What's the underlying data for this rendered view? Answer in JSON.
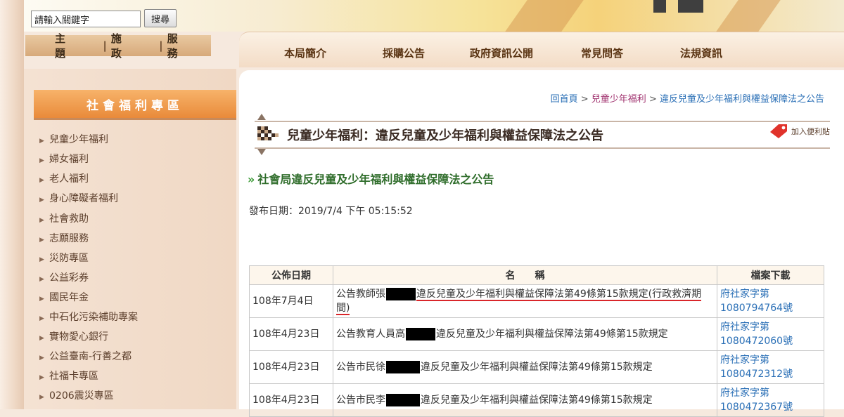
{
  "header": {
    "search": {
      "value": "請輸入關鍵字",
      "button_label": "搜尋"
    },
    "theme_tabs": [
      "主　題",
      "施　政",
      "服　務"
    ]
  },
  "top_nav": {
    "items": [
      "本局簡介",
      "採購公告",
      "政府資訊公開",
      "常見問答",
      "法規資訊"
    ]
  },
  "sidebar": {
    "title": "社會福利專區",
    "items": [
      "兒童少年福利",
      "婦女福利",
      "老人福利",
      "身心障礙者福利",
      "社會救助",
      "志願服務",
      "災防專區",
      "公益彩券",
      "國民年金",
      "中石化污染補助專案",
      "實物愛心銀行",
      "公益臺南-行善之都",
      "社福卡專區",
      "0206震災專區"
    ]
  },
  "breadcrumb": {
    "home": "回首頁",
    "sep": " > ",
    "category": "兒童少年福利",
    "current": "違反兒童及少年福利與權益保障法之公告"
  },
  "page": {
    "title": "兒童少年福利：違反兒童及少年福利與權益保障法之公告",
    "bookmark": "加入便利貼",
    "subtitle": "社會局違反兒童及少年福利與權益保障法之公告",
    "publish_date": "發布日期：2019/7/4 下午 05:15:52"
  },
  "table": {
    "headers": [
      "公佈日期",
      "名　　稱",
      "檔案下載"
    ],
    "rows": [
      {
        "date": "108年7月4日",
        "name_before": "公告教師張",
        "name_after": "違反兒童及少年福利與權益保障法第49條第15款規定(行政救濟期間)",
        "file": "府社家字第1080794764號"
      },
      {
        "date": "108年4月23日",
        "name_before": "公告教育人員高",
        "name_after": "違反兒童及少年福利與權益保障法第49條第15款規定",
        "file": "府社家字第1080472060號"
      },
      {
        "date": "108年4月23日",
        "name_before": "公告市民徐",
        "name_after": "違反兒童及少年福利與權益保障法第49條第15款規定",
        "file": "府社家字第1080472312號"
      },
      {
        "date": "108年4月23日",
        "name_before": "公告市民李",
        "name_after": "違反兒童及少年福利與權益保障法第49條第15款規定",
        "file": "府社家字第1080472367號"
      }
    ]
  },
  "colors": {
    "accent_orange": "#e98a3a",
    "link_blue": "#2a6fb6",
    "subtitle_green": "#2f6d2b"
  }
}
